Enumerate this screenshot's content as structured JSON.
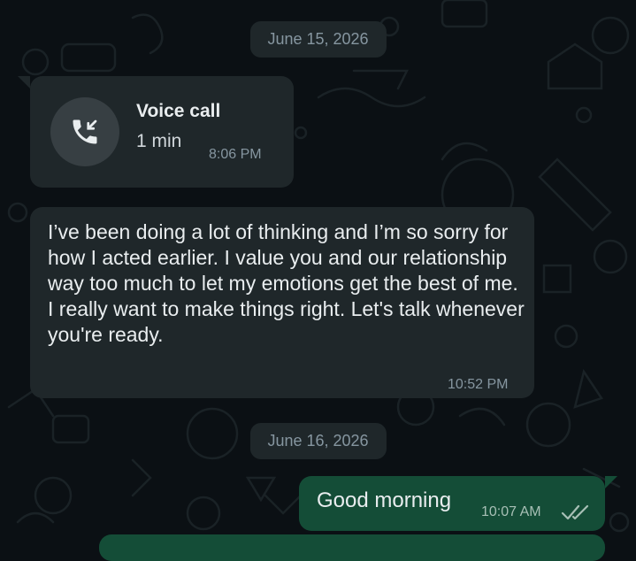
{
  "chat": {
    "date_1": "June 15, 2026",
    "call": {
      "title": "Voice call",
      "duration": "1 min",
      "time": "8:06 PM",
      "icon": "incoming-call-icon"
    },
    "message_1": {
      "text": "I’ve been doing a lot of thinking and I’m so sorry for how I acted earlier. I value you and our relationship way too much to let my emotions get the best of me. I really want to make things right. Let's talk whenever you're ready.",
      "time": "10:52 PM"
    },
    "date_2": "June 16, 2026",
    "message_2": {
      "text": "Good morning",
      "time": "10:07 AM",
      "status_icon": "double-check-icon"
    }
  },
  "colors": {
    "background": "#0b1014",
    "incoming_bubble": "#1f272a",
    "outgoing_bubble": "#144d37",
    "meta_text": "#8696a0"
  }
}
